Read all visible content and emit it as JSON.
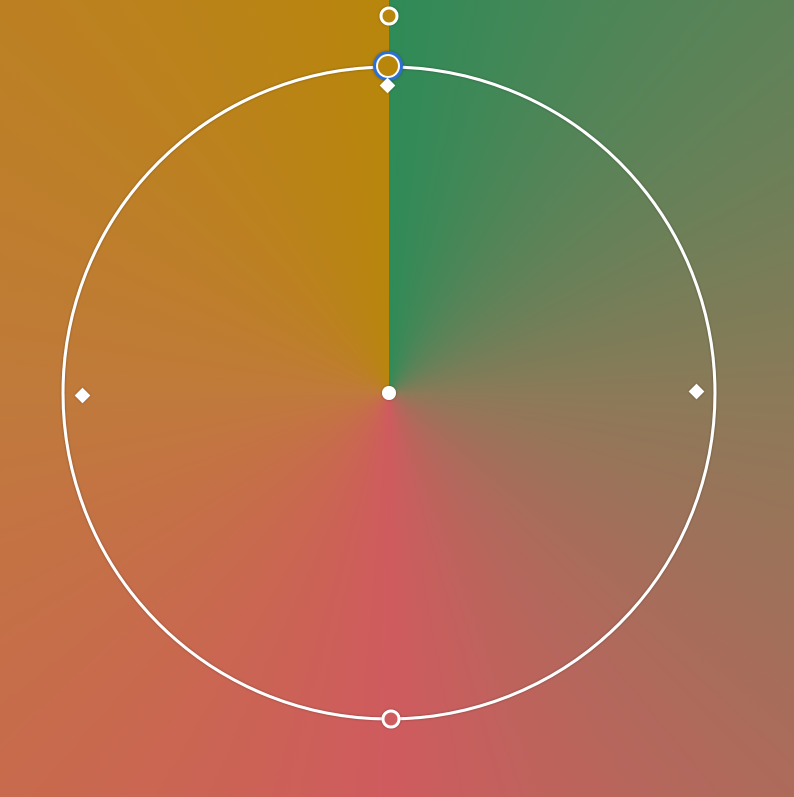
{
  "gradient_editor": {
    "gradient_type": "conic",
    "start_angle_deg": 0,
    "stops": [
      {
        "color": "#2e8b57",
        "position": 0.0
      },
      {
        "color": "#8b7a58",
        "position": 0.25
      },
      {
        "color": "#cf5b5e",
        "position": 0.5
      },
      {
        "color": "#c07a3b",
        "position": 0.75
      },
      {
        "color": "#b8860b",
        "position": 1.0
      }
    ],
    "selected_stop_index": 4
  },
  "colors": {
    "overlay_line": "#ffffff",
    "selection_accent": "#2f6fd1",
    "center_handle": "#ffffff"
  },
  "icons": {
    "angle_handle": "circle-handle-icon",
    "selected_stop_handle": "selected-color-stop-icon",
    "center_handle": "center-point-icon",
    "diamond_handle": "diamond-handle-icon",
    "bottom_handle": "circle-handle-icon"
  }
}
